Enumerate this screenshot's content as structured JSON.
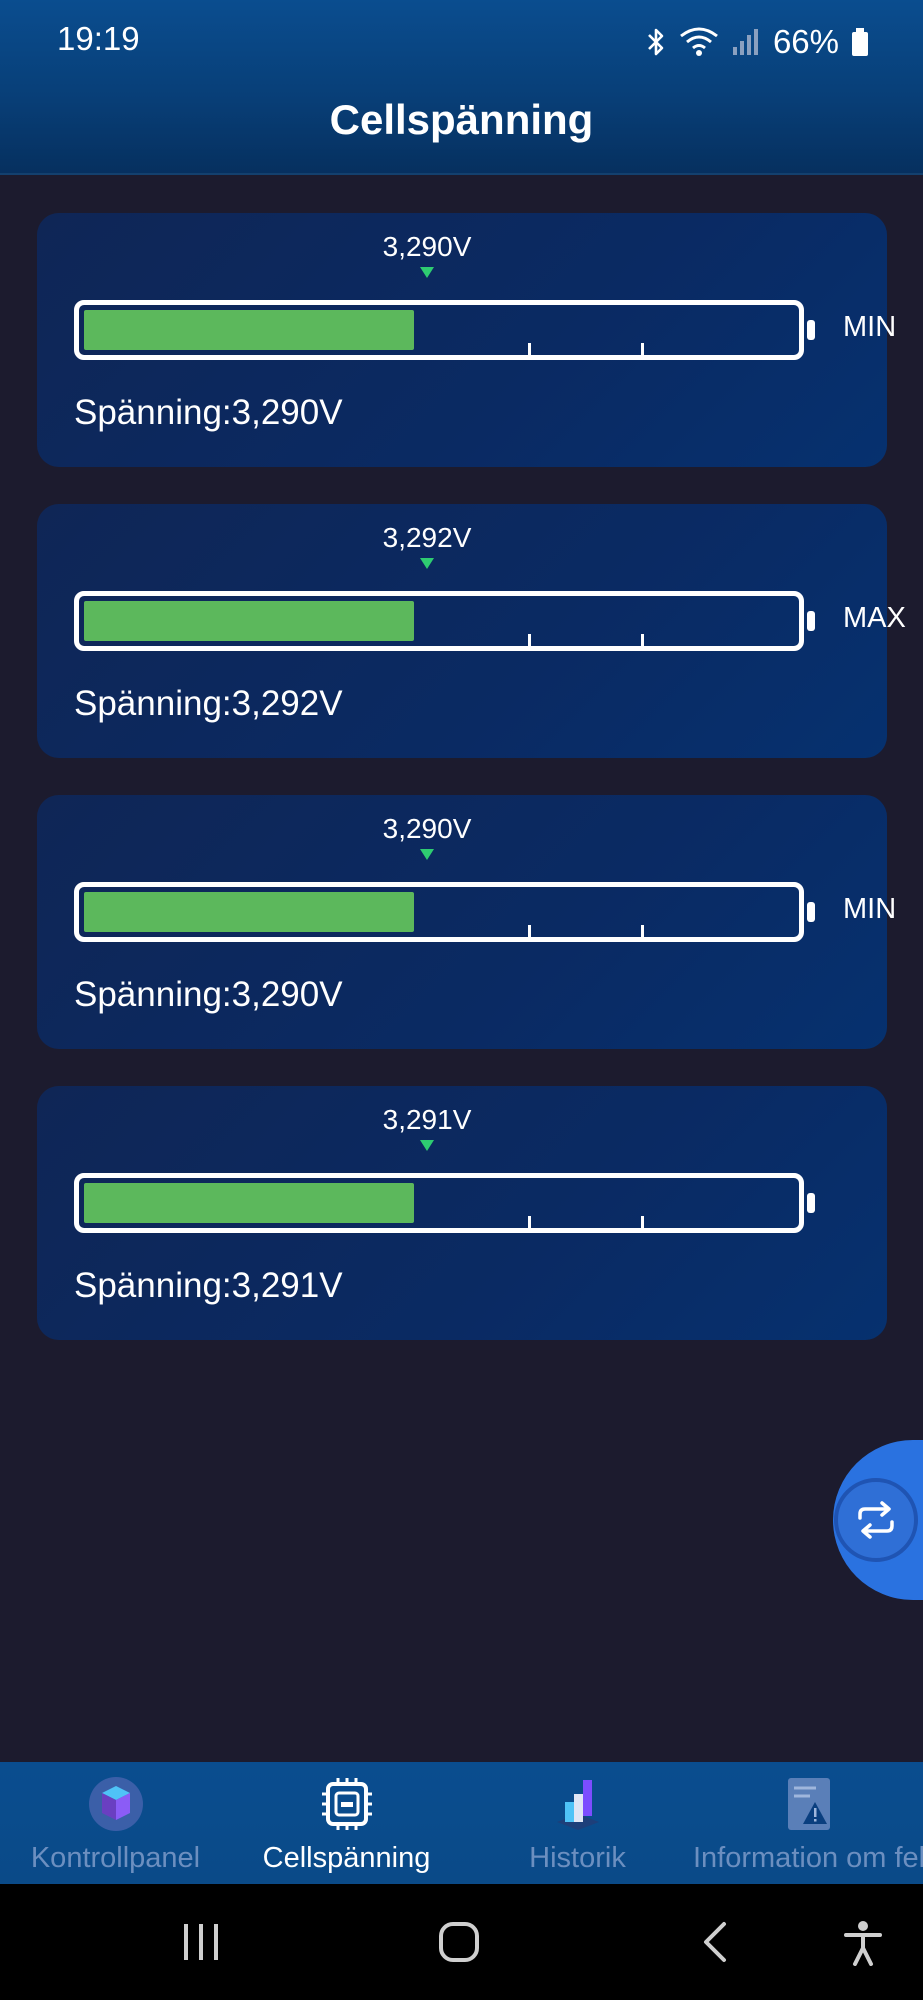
{
  "status_bar": {
    "time": "19:19",
    "battery_percent": "66%",
    "icons": [
      "bluetooth-icon",
      "wifi-icon",
      "signal-icon",
      "battery-icon"
    ]
  },
  "header": {
    "title": "Cellspänning"
  },
  "cells": [
    {
      "marker_value": "3,290V",
      "tag": "MIN",
      "voltage_text": "Spänning:3,290V",
      "fill_fraction": 0.5
    },
    {
      "marker_value": "3,292V",
      "tag": "MAX",
      "voltage_text": "Spänning:3,292V",
      "fill_fraction": 0.5
    },
    {
      "marker_value": "3,290V",
      "tag": "MIN",
      "voltage_text": "Spänning:3,290V",
      "fill_fraction": 0.5
    },
    {
      "marker_value": "3,291V",
      "tag": "",
      "voltage_text": "Spänning:3,291V",
      "fill_fraction": 0.5
    }
  ],
  "floating_button": {
    "icon": "swap-icon"
  },
  "bottom_nav": {
    "items": [
      {
        "label": "Kontrollpanel",
        "icon": "dashboard-icon",
        "active": false
      },
      {
        "label": "Cellspänning",
        "icon": "chip-icon",
        "active": true
      },
      {
        "label": "Historik",
        "icon": "history-chart-icon",
        "active": false
      },
      {
        "label": "Information om fel",
        "icon": "error-info-icon",
        "active": false
      }
    ]
  },
  "system_nav": {
    "buttons": [
      "recents-button",
      "home-button",
      "back-button",
      "accessibility-button"
    ]
  },
  "colors": {
    "background": "#1c1b2e",
    "header": "#0a4d8f",
    "bar_fill": "#5cb85c",
    "marker": "#2ecc71",
    "fab": "#2f6fd6",
    "nav_inactive": "#6c8fc0"
  }
}
